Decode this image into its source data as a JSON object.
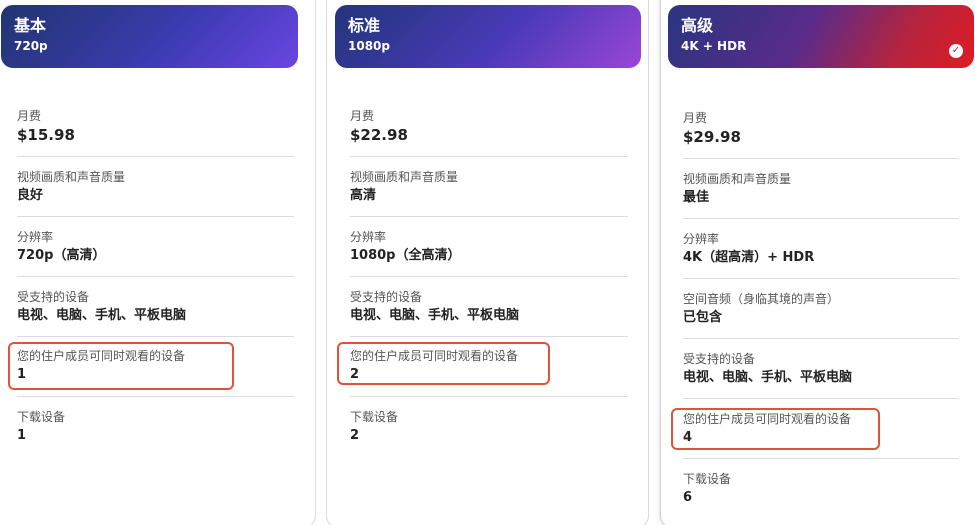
{
  "plans": [
    {
      "name": "基本",
      "resolution": "720p",
      "selected": false,
      "rows": [
        {
          "label": "月费",
          "value": "$15.98"
        },
        {
          "label": "视频画质和声音质量",
          "value": "良好"
        },
        {
          "label": "分辨率",
          "value": "720p（高清）"
        },
        {
          "label": "受支持的设备",
          "value": "电视、电脑、手机、平板电脑"
        },
        {
          "label": "您的住户成员可同时观看的设备",
          "value": "1"
        },
        {
          "label": "下载设备",
          "value": "1"
        }
      ]
    },
    {
      "name": "标准",
      "resolution": "1080p",
      "selected": false,
      "rows": [
        {
          "label": "月费",
          "value": "$22.98"
        },
        {
          "label": "视频画质和声音质量",
          "value": "高清"
        },
        {
          "label": "分辨率",
          "value": "1080p（全高清）"
        },
        {
          "label": "受支持的设备",
          "value": "电视、电脑、手机、平板电脑"
        },
        {
          "label": "您的住户成员可同时观看的设备",
          "value": "2"
        },
        {
          "label": "下载设备",
          "value": "2"
        }
      ]
    },
    {
      "name": "高级",
      "resolution": "4K + HDR",
      "selected": true,
      "rows": [
        {
          "label": "月费",
          "value": "$29.98"
        },
        {
          "label": "视频画质和声音质量",
          "value": "最佳"
        },
        {
          "label": "分辨率",
          "value": "4K（超高清）+ HDR"
        },
        {
          "label": "空间音频（身临其境的声音）",
          "value": "已包含"
        },
        {
          "label": "受支持的设备",
          "value": "电视、电脑、手机、平板电脑"
        },
        {
          "label": "您的住户成员可同时观看的设备",
          "value": "4"
        },
        {
          "label": "下载设备",
          "value": "6"
        }
      ]
    }
  ],
  "icons": {
    "selected_check": "checkmark-icon"
  },
  "colors": {
    "highlight_border": "#e0523a",
    "selected_check": "#d01f2a"
  }
}
